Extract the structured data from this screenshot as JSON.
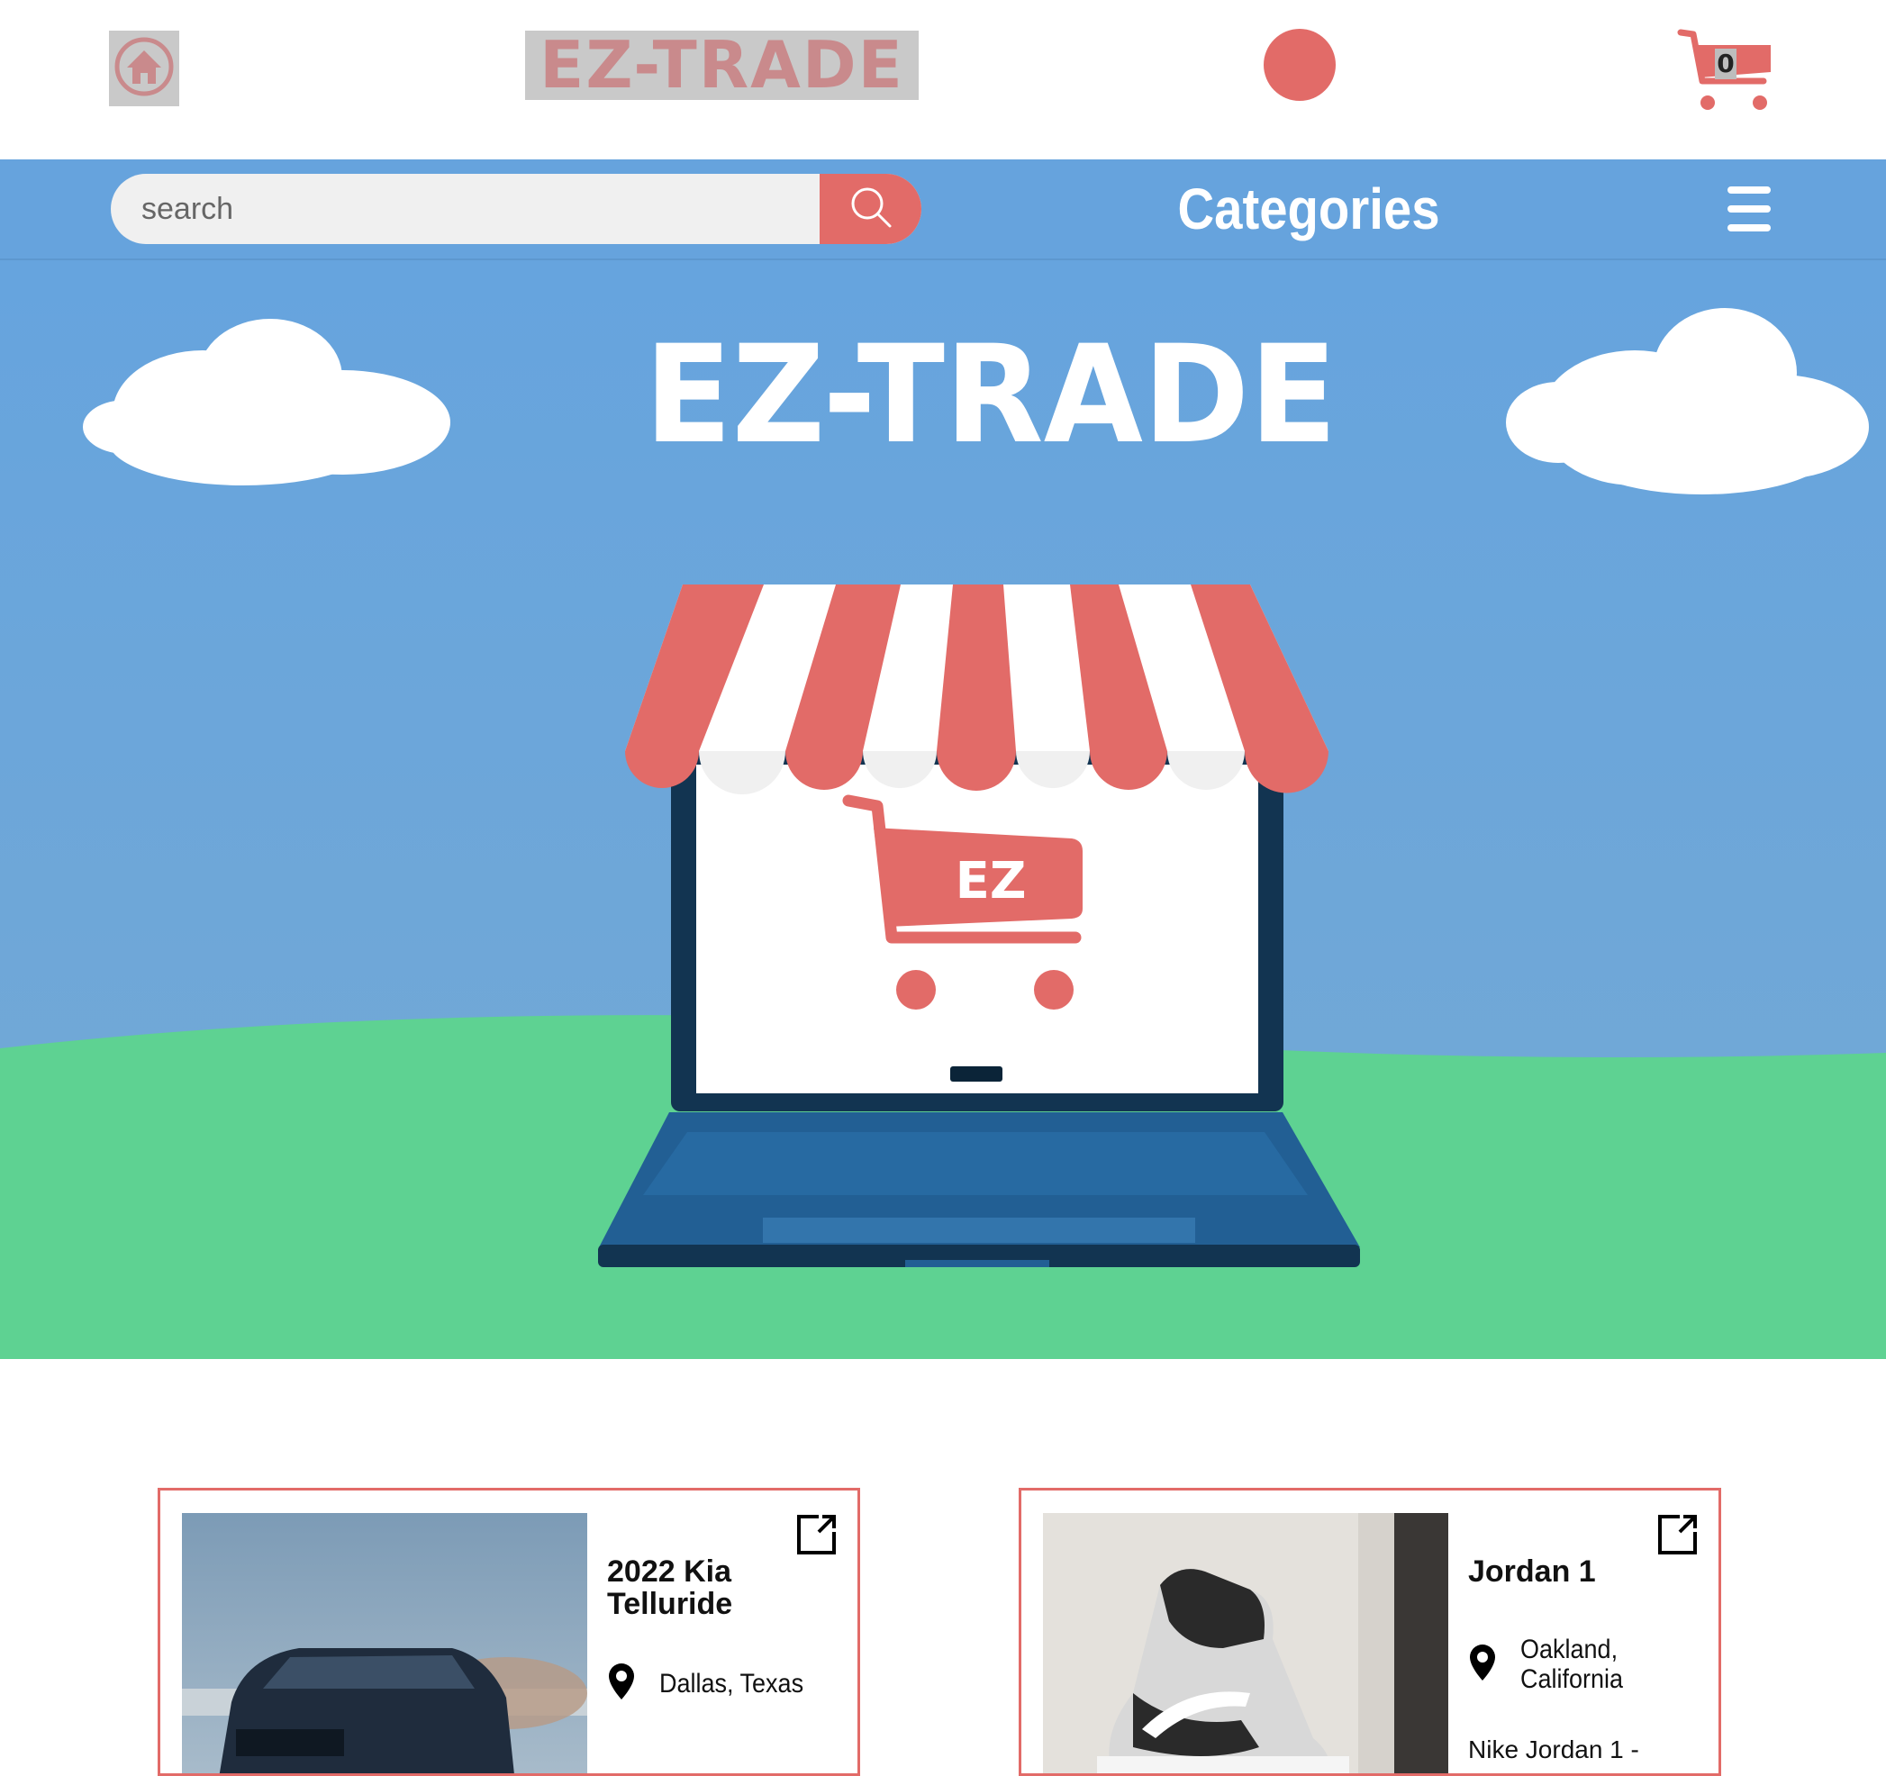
{
  "app": {
    "logo_text": "EZ-TRADE",
    "hero_brand": "EZ-TRADE",
    "cart_badge_text": "EZ"
  },
  "header": {
    "home_icon": "home-icon",
    "cart_count": "0",
    "cart_icon": "cart-icon"
  },
  "nav": {
    "search_placeholder": "search",
    "search_icon": "search-icon",
    "categories_label": "Categories",
    "menu_icon": "hamburger-menu-icon"
  },
  "colors": {
    "accent_red": "#e26b68",
    "nav_blue": "#66a3dd",
    "sky_blue": "#6aa9dc",
    "grass_green": "#5ed292",
    "laptop_dark": "#123451",
    "laptop_keyboard": "#225f94"
  },
  "listings": [
    {
      "title": "2022 Kia Telluride",
      "location": "Dallas, Texas",
      "description": "",
      "image": "dark-suv-photo",
      "open_icon": "open-external-icon",
      "location_icon": "map-pin-icon"
    },
    {
      "title": "Jordan 1",
      "location": "Oakland, California",
      "description": "Nike Jordan 1 -",
      "image": "sneaker-photo",
      "open_icon": "open-external-icon",
      "location_icon": "map-pin-icon"
    }
  ]
}
